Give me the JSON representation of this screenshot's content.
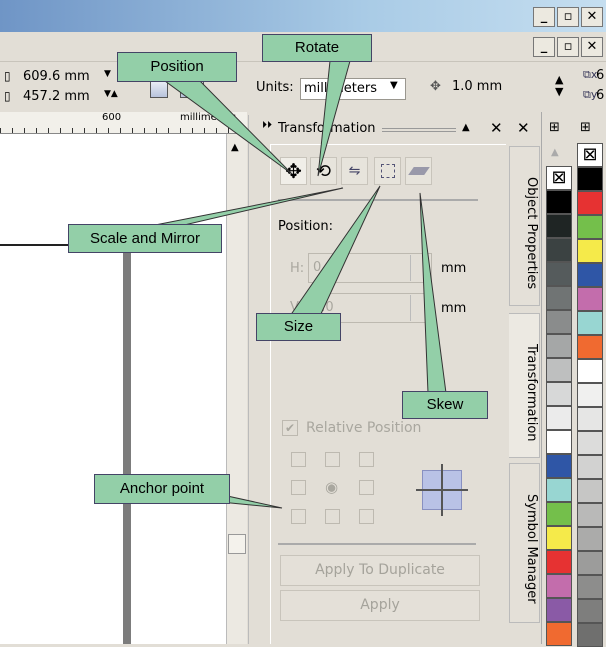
{
  "window": {
    "minimize": "_",
    "restore": "▫",
    "close": "✕"
  },
  "toolbar": {
    "width_value": "609.6 mm",
    "height_value": "457.2 mm",
    "units_label": "Units:",
    "units_value": "millimeters",
    "nudge_value": "1.0 mm",
    "dup_x": "6",
    "dup_y": "6"
  },
  "ruler": {
    "tick_label": "600",
    "unit_label": "millimeters"
  },
  "docker": {
    "title": "Transformation",
    "tabs": [
      "Position",
      "Rotate",
      "Scale and Mirror",
      "Size",
      "Skew"
    ],
    "section_label": "Position:",
    "h_label": "H:",
    "h_value": "0.0",
    "h_unit": "mm",
    "v_label": "V:",
    "v_value": "0.0",
    "v_unit": "mm",
    "relative_position_label": "Relative Position",
    "relative_position_checked": true,
    "apply_duplicate_label": "Apply To Duplicate",
    "apply_label": "Apply"
  },
  "side_tabs": [
    "Object Properties",
    "Transformation",
    "Symbol Manager"
  ],
  "palette": {
    "col1": [
      "#000000",
      "#1f2524",
      "#3b4242",
      "#555b5c",
      "#707474",
      "#8a8c8c",
      "#a5a7a7",
      "#bebfbf",
      "#d7d8d8",
      "#ebebeb",
      "#ffffff",
      "#2f56a6",
      "#98d6d2",
      "#74bf4b",
      "#f5ea4a",
      "#e63232",
      "#c36dac",
      "#8a5aa6",
      "#f06a30"
    ],
    "col2": [
      "#000000",
      "#e63232",
      "#74bf4b",
      "#f5ea4a",
      "#2f56a6",
      "#c36dac",
      "#98d6d2",
      "#f06a30",
      "#ffffff",
      "#f0f0ef",
      "#e6e6e5",
      "#dcdcdb",
      "#d2d2d1",
      "#c6c6c5",
      "#b9b9b8",
      "#ababaa",
      "#9c9c9b",
      "#8d8d8c",
      "#7e7e7d",
      "#6f6f6e"
    ]
  },
  "callouts": {
    "position": "Position",
    "rotate": "Rotate",
    "scale": "Scale and Mirror",
    "size": "Size",
    "skew": "Skew",
    "anchor": "Anchor point"
  },
  "colors": {
    "callout": "#93cfa8",
    "titlebar": "#6f95c6"
  }
}
